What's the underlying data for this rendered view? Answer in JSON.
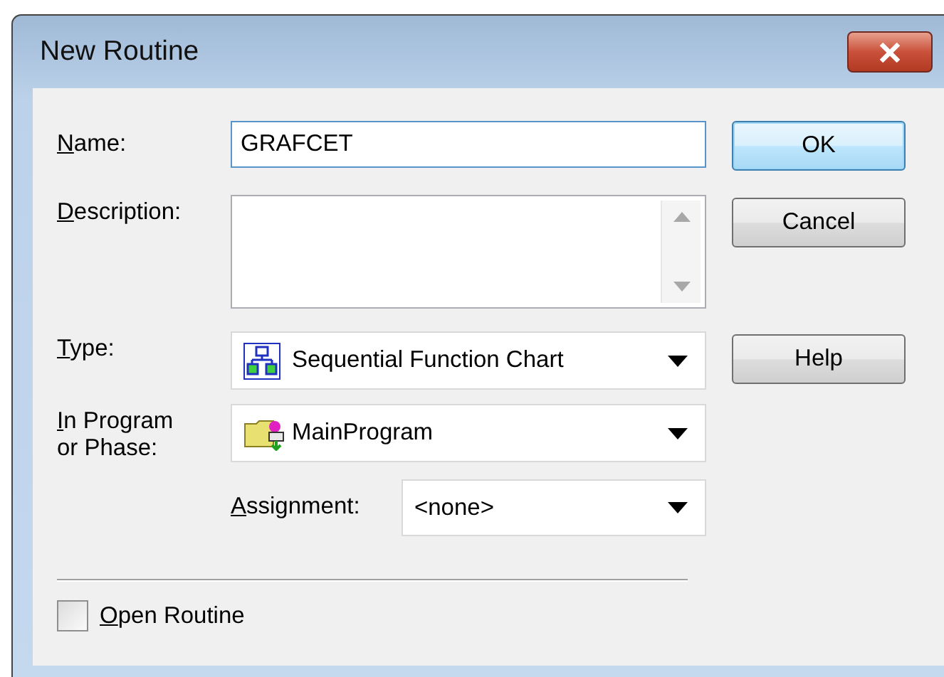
{
  "window": {
    "title": "New Routine"
  },
  "fields": [
    {
      "kind": "text",
      "label": "Name:",
      "mnemonic": true,
      "value": "GRAFCET",
      "focused": true
    },
    {
      "kind": "textarea",
      "label": "Description:",
      "mnemonic": true
    },
    {
      "kind": "dropdown",
      "label": "Type:",
      "mnemonic": true,
      "value": "Sequential Function Chart"
    },
    {
      "kind": "dropdown",
      "label": "In Program\nor Phase:",
      "mnemonic": true,
      "value": "MainProgram"
    },
    {
      "kind": "subdropdown",
      "label": "Assignment:",
      "mnemonic": true,
      "value": "<none>"
    }
  ],
  "buttons": [
    {
      "label": "OK",
      "default": true
    },
    {
      "label": "Cancel",
      "default": false
    },
    {
      "label": "Help",
      "default": false
    }
  ],
  "checkbox": {
    "label": "Open Routine",
    "mnemonic": true,
    "checked": false
  }
}
